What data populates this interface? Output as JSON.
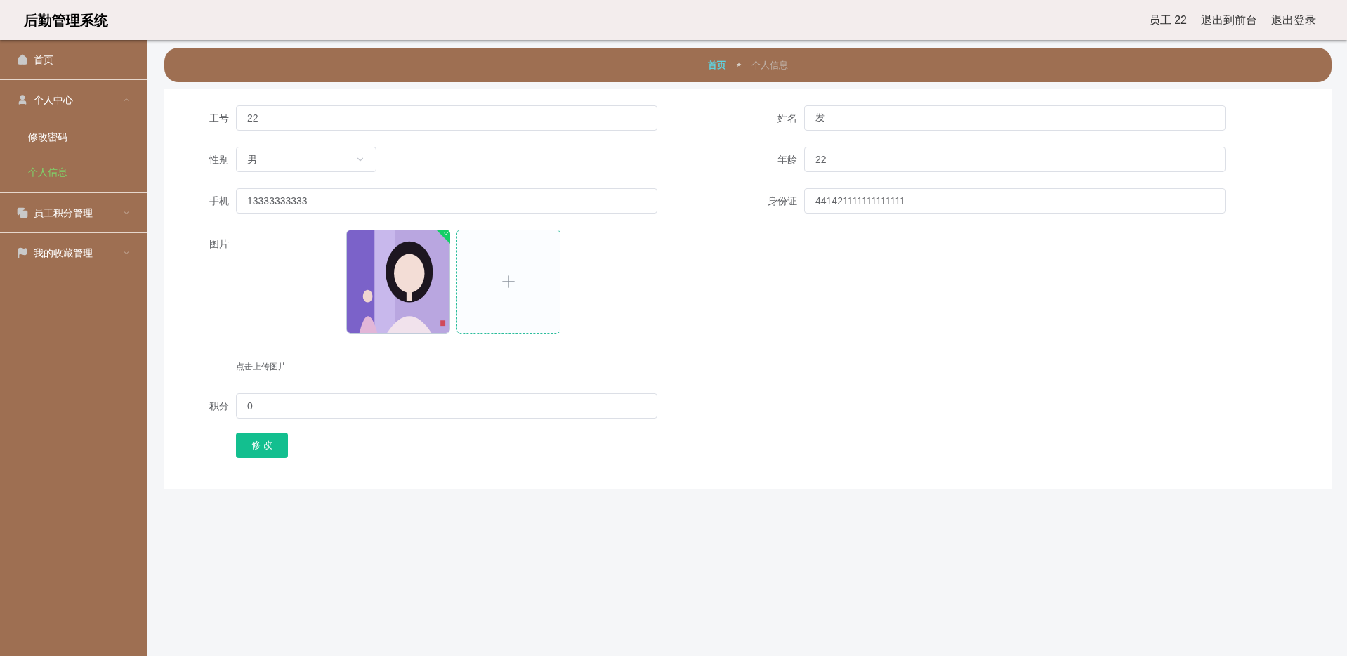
{
  "header": {
    "title": "后勤管理系统",
    "links": [
      "员工 22",
      "退出到前台",
      "退出登录"
    ]
  },
  "sidebar": {
    "items": [
      {
        "label": "首页"
      },
      {
        "label": "个人中心",
        "expanded": true,
        "children": [
          {
            "label": "修改密码",
            "selected": false
          },
          {
            "label": "个人信息",
            "selected": true
          }
        ]
      },
      {
        "label": "员工积分管理",
        "expanded": false
      },
      {
        "label": "我的收藏管理",
        "expanded": false
      }
    ]
  },
  "breadcrumb_separator": "★",
  "breadcrumb": [
    {
      "label": "首页",
      "selected": true
    },
    {
      "label": "个人信息",
      "selected": false
    }
  ],
  "form": {
    "rows": [
      [
        {
          "label": "工号",
          "kind": "input",
          "value": "22"
        },
        {
          "label": "姓名",
          "kind": "input",
          "value": "发"
        }
      ],
      [
        {
          "label": "性别",
          "kind": "select",
          "value": "男"
        },
        {
          "label": "年龄",
          "kind": "input",
          "value": "22"
        }
      ],
      [
        {
          "label": "手机",
          "kind": "input",
          "value": "13333333333"
        },
        {
          "label": "身份证",
          "kind": "input",
          "value": "441421111111111111"
        }
      ]
    ],
    "upload": {
      "label": "图片",
      "images": [
        {
          "kind": "picture",
          "uploaded": true
        }
      ],
      "hint": "点击上传图片"
    },
    "points": {
      "label": "积分",
      "value": "0"
    },
    "submit": "修 改"
  }
}
